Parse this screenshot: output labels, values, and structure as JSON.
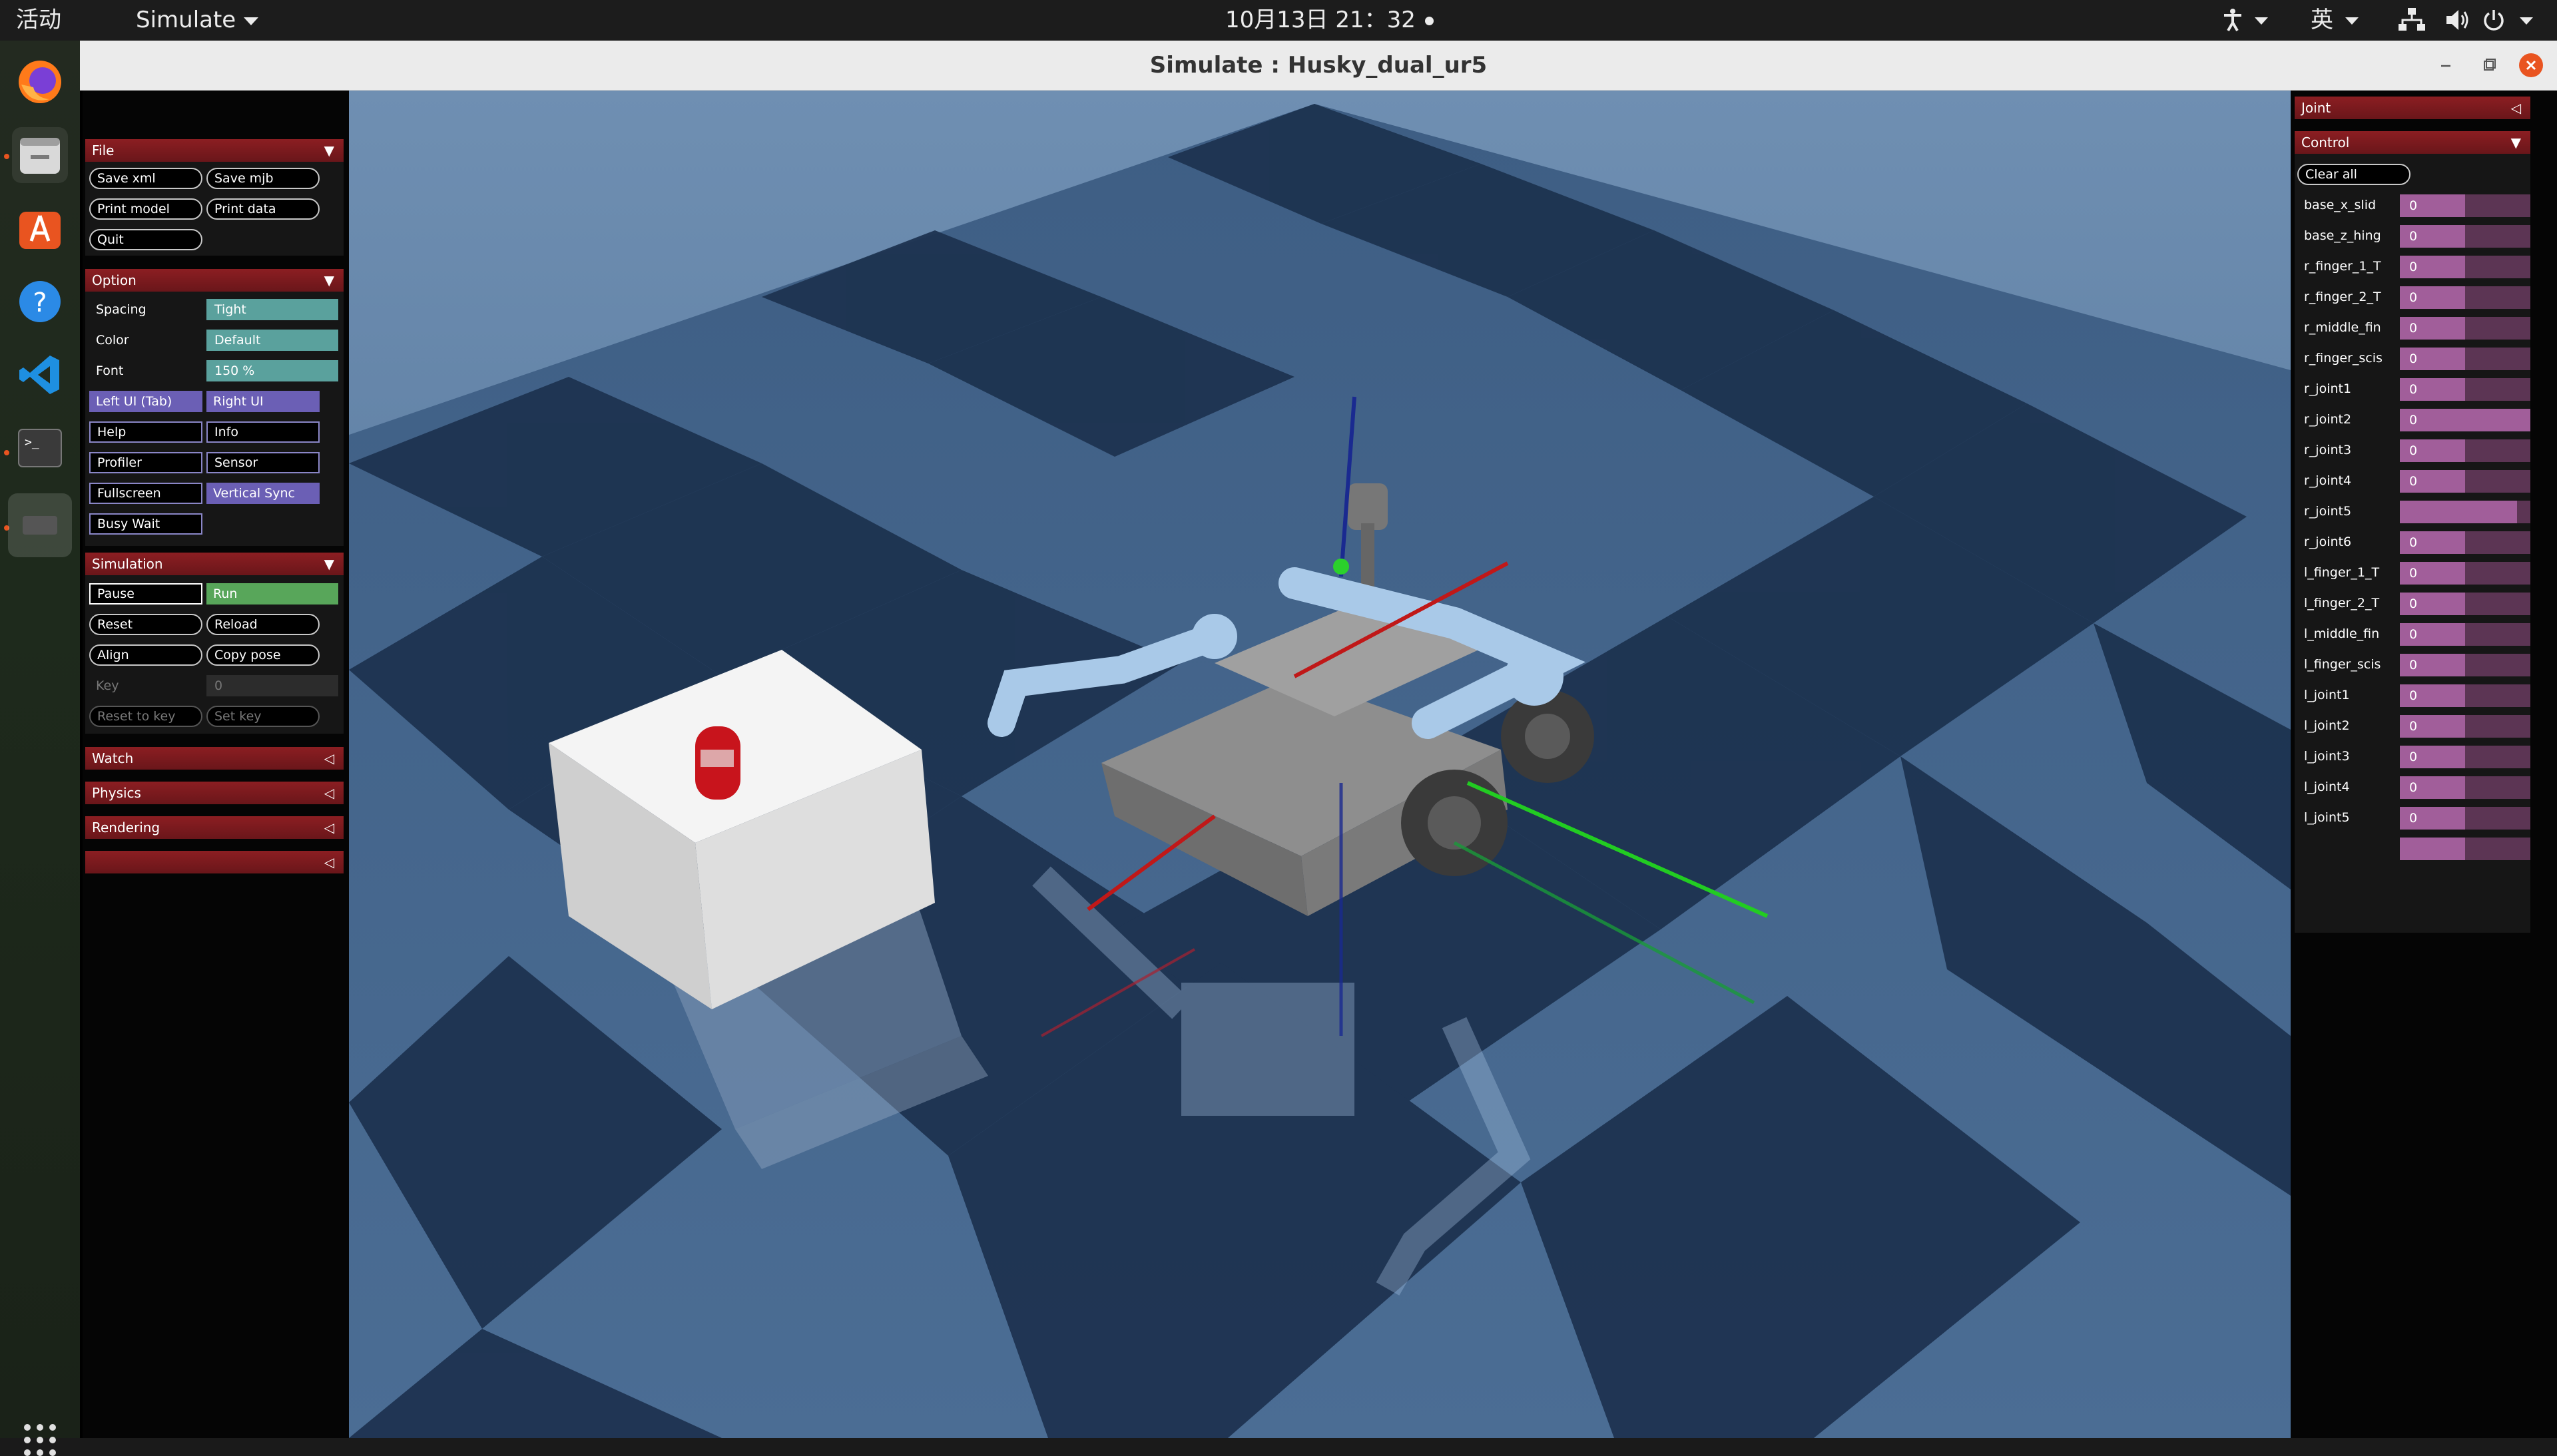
{
  "topbar": {
    "activities": "活动",
    "app_menu": "Simulate",
    "clock": "10月13日  21：32",
    "ime": "英"
  },
  "dock": {
    "items": [
      "firefox-icon",
      "files-icon",
      "app-center-icon",
      "help-icon",
      "vscode-icon",
      "terminal-icon",
      "running-app-icon"
    ],
    "show_apps": "show-apps-icon"
  },
  "window": {
    "title": "Simulate : Husky_dual_ur5"
  },
  "left_panel": {
    "file": {
      "header": "File",
      "buttons": [
        "Save xml",
        "Save mjb",
        "Print model",
        "Print data",
        "Quit"
      ]
    },
    "option": {
      "header": "Option",
      "spacing_label": "Spacing",
      "spacing_value": "Tight",
      "color_label": "Color",
      "color_value": "Default",
      "font_label": "Font",
      "font_value": "150 %",
      "toggles": [
        "Left UI (Tab)",
        "Right UI",
        "Help",
        "Info",
        "Profiler",
        "Sensor",
        "Fullscreen",
        "Vertical Sync",
        "Busy Wait"
      ],
      "toggles_on": [
        "Left UI (Tab)",
        "Right UI",
        "Vertical Sync"
      ]
    },
    "simulation": {
      "header": "Simulation",
      "pause": "Pause",
      "run": "Run",
      "reset": "Reset",
      "reload": "Reload",
      "align": "Align",
      "copy_pose": "Copy pose",
      "key_label": "Key",
      "key_value": "0",
      "reset_to_key": "Reset to key",
      "set_key": "Set key"
    },
    "collapsed": [
      "Watch",
      "Physics",
      "Rendering",
      ""
    ]
  },
  "right_panel": {
    "joint_header": "Joint",
    "control_header": "Control",
    "clear_all": "Clear all",
    "controls": [
      {
        "name": "base_x_slid",
        "value": "0",
        "fill": 0.5
      },
      {
        "name": "base_z_hing",
        "value": "0",
        "fill": 0.5
      },
      {
        "name": "r_finger_1_T",
        "value": "0",
        "fill": 0.5
      },
      {
        "name": "r_finger_2_T",
        "value": "0",
        "fill": 0.5
      },
      {
        "name": "r_middle_fin",
        "value": "0",
        "fill": 0.5
      },
      {
        "name": "r_finger_scis",
        "value": "0",
        "fill": 0.5
      },
      {
        "name": "r_joint1",
        "value": "0",
        "fill": 0.5
      },
      {
        "name": "r_joint2",
        "value": "0",
        "fill": 1.0
      },
      {
        "name": "r_joint3",
        "value": "0",
        "fill": 0.5
      },
      {
        "name": "r_joint4",
        "value": "0",
        "fill": 0.5
      },
      {
        "name": "r_joint5",
        "value": "",
        "fill": 0.9
      },
      {
        "name": "r_joint6",
        "value": "0",
        "fill": 0.5
      },
      {
        "name": "l_finger_1_T",
        "value": "0",
        "fill": 0.5
      },
      {
        "name": "l_finger_2_T",
        "value": "0",
        "fill": 0.5
      },
      {
        "name": "l_middle_fin",
        "value": "0",
        "fill": 0.5
      },
      {
        "name": "l_finger_scis",
        "value": "0",
        "fill": 0.5
      },
      {
        "name": "l_joint1",
        "value": "0",
        "fill": 0.5
      },
      {
        "name": "l_joint2",
        "value": "0",
        "fill": 0.5
      },
      {
        "name": "l_joint3",
        "value": "0",
        "fill": 0.5
      },
      {
        "name": "l_joint4",
        "value": "0",
        "fill": 0.5
      },
      {
        "name": "l_joint5",
        "value": "0",
        "fill": 0.5
      },
      {
        "name": "",
        "value": "",
        "fill": 0.5
      }
    ]
  },
  "colors": {
    "section_header": "#8c1e22",
    "toggle_on": "#6b5fb5",
    "run_active": "#58a65a",
    "option_value": "#5aa19d",
    "slider_fill": "#a15e9a",
    "slider_track": "#5c3554",
    "close_button": "#e95420"
  }
}
